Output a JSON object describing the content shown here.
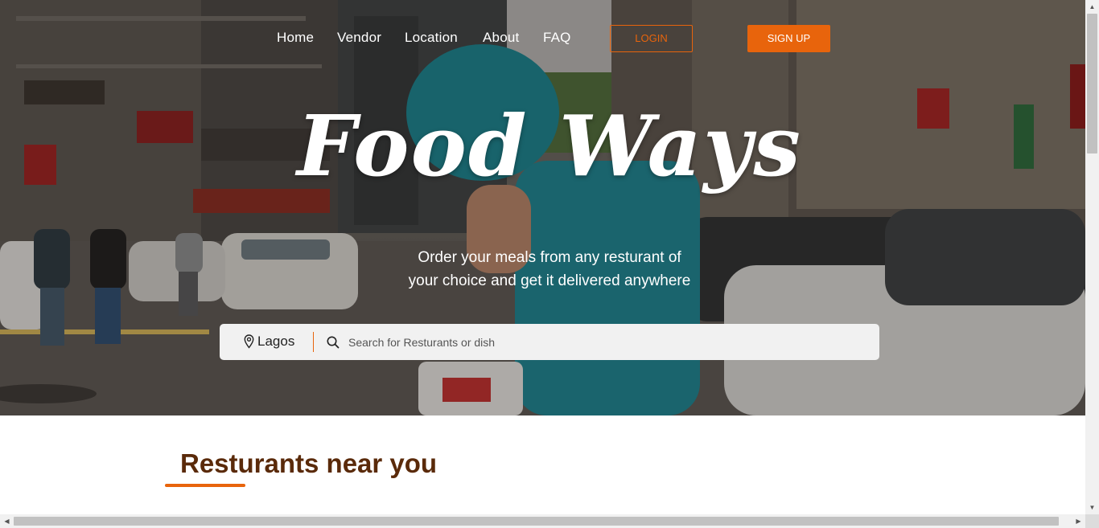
{
  "nav": {
    "items": [
      "Home",
      "Vendor",
      "Location",
      "About",
      "FAQ"
    ],
    "login_label": "LOGIN",
    "signup_label": "SIGN UP"
  },
  "hero": {
    "logo": "Food Ways",
    "tagline_line1": "Order your meals from any resturant of",
    "tagline_line2": "your choice and get it delivered anywhere"
  },
  "search": {
    "location": "Lagos",
    "placeholder": "Search for Resturants or dish",
    "value": ""
  },
  "section": {
    "title": "Resturants near you"
  },
  "colors": {
    "accent": "#e8640c",
    "heading": "#5a2a0a"
  },
  "icons": {
    "location": "map-pin-icon",
    "search": "magnifier-icon"
  }
}
